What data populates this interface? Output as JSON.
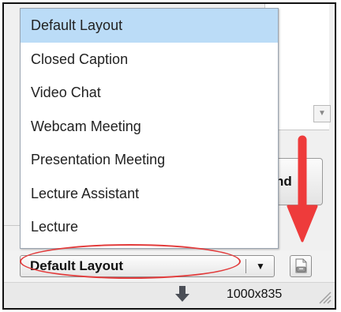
{
  "dropdown": {
    "items": [
      {
        "label": "Default Layout",
        "selected": true
      },
      {
        "label": "Closed Caption",
        "selected": false
      },
      {
        "label": "Video Chat",
        "selected": false
      },
      {
        "label": "Webcam Meeting",
        "selected": false
      },
      {
        "label": "Presentation Meeting",
        "selected": false
      },
      {
        "label": "Lecture Assistant",
        "selected": false
      },
      {
        "label": "Lecture",
        "selected": false
      }
    ]
  },
  "background": {
    "send_button_label": "nd",
    "scroll_arrow_glyph": "▼"
  },
  "layout_select": {
    "value": "Default Layout",
    "arrow_glyph": "▼"
  },
  "status_bar": {
    "resolution": "1000x835"
  },
  "icons": {
    "save_layout": "save-layout-icon",
    "download_arrow": "down-arrow-icon",
    "resize_grip": "resize-grip-icon"
  },
  "colors": {
    "selection": "#bbdcf7",
    "annotation_red": "#e23b3b"
  }
}
